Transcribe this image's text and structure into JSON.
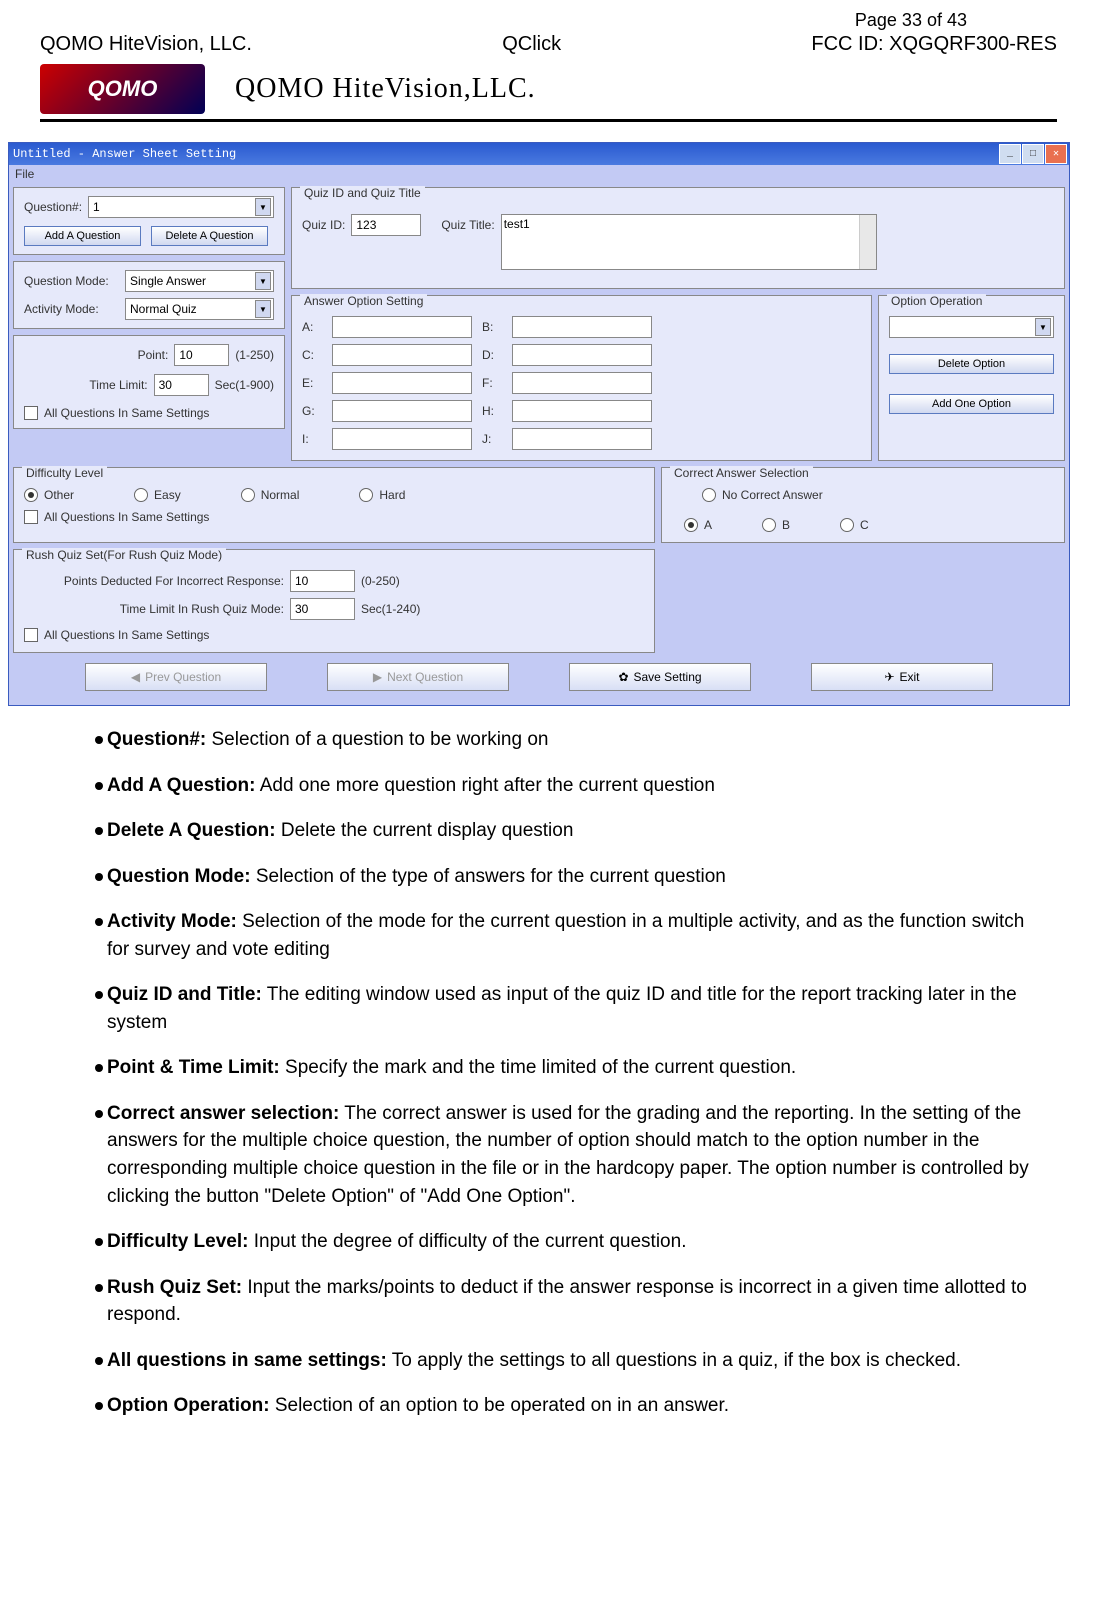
{
  "header": {
    "page_num": "Page 33 of 43",
    "company": "QOMO HiteVision, LLC.",
    "product": "QClick",
    "fcc": "FCC ID: XQGQRF300-RES",
    "logo_text": "QOMO",
    "logo_sub": "QOMO HiteVision,LLC."
  },
  "window": {
    "title": "Untitled - Answer Sheet Setting",
    "menu_file": "File",
    "left": {
      "question_num_label": "Question#:",
      "question_num_value": "1",
      "add_question_btn": "Add A Question",
      "delete_question_btn": "Delete A Question",
      "question_mode_label": "Question Mode:",
      "question_mode_value": "Single Answer",
      "activity_mode_label": "Activity Mode:",
      "activity_mode_value": "Normal Quiz",
      "point_label": "Point:",
      "point_value": "10",
      "point_range": "(1-250)",
      "time_limit_label": "Time Limit:",
      "time_limit_value": "30",
      "time_limit_range": "Sec(1-900)",
      "all_same_1": "All Questions In Same Settings"
    },
    "quiz": {
      "fieldset_label": "Quiz ID and Quiz Title",
      "quiz_id_label": "Quiz ID:",
      "quiz_id_value": "123",
      "quiz_title_label": "Quiz Title:",
      "quiz_title_value": "test1"
    },
    "answers": {
      "fieldset_label": "Answer Option Setting",
      "A": "A:",
      "B": "B:",
      "C": "C:",
      "D": "D:",
      "E": "E:",
      "F": "F:",
      "G": "G:",
      "H": "H:",
      "I": "I:",
      "J": "J:"
    },
    "option_op": {
      "fieldset_label": "Option Operation",
      "delete_btn": "Delete Option",
      "add_btn": "Add One Option"
    },
    "difficulty": {
      "fieldset_label": "Difficulty Level",
      "other": "Other",
      "easy": "Easy",
      "normal": "Normal",
      "hard": "Hard",
      "all_same": "All Questions In Same Settings"
    },
    "correct": {
      "fieldset_label": "Correct Answer Selection",
      "no_correct": "No Correct Answer",
      "A": "A",
      "B": "B",
      "C": "C"
    },
    "rush": {
      "fieldset_label": "Rush Quiz Set(For Rush Quiz Mode)",
      "points_label": "Points Deducted For Incorrect Response:",
      "points_value": "10",
      "points_range": "(0-250)",
      "time_label": "Time Limit In Rush Quiz Mode:",
      "time_value": "30",
      "time_range": "Sec(1-240)",
      "all_same": "All Questions In Same Settings"
    },
    "buttons": {
      "prev": "Prev Question",
      "next": "Next Question",
      "save": "Save Setting",
      "exit": "Exit"
    }
  },
  "bullets": [
    {
      "term": "Question#:",
      "desc": " Selection of a question to be working on"
    },
    {
      "term": "Add A Question:",
      "desc": " Add one more question right after the current question"
    },
    {
      "term": "Delete A Question:",
      "desc": " Delete the current display question"
    },
    {
      "term": "Question Mode:",
      "desc": " Selection of the type of answers for the current question"
    },
    {
      "term": "Activity Mode:",
      "desc": " Selection of the mode for the current question in a multiple activity, and as the function switch for survey and vote editing"
    },
    {
      "term": "Quiz ID and Title:",
      "desc": " The editing window used as input of the quiz ID and title for the report tracking later in the system"
    },
    {
      "term": "Point & Time Limit:",
      "desc": " Specify the mark and the time limited of the current question."
    },
    {
      "term": "Correct answer selection:",
      "desc": " The correct answer is used for the grading and the reporting. In the setting of the answers for the multiple choice question, the number of option should match to the option number in the corresponding multiple choice question in the file or in the hardcopy paper. The option number is controlled by clicking the button \"Delete Option\" of \"Add One Option\"."
    },
    {
      "term": "Difficulty Level:",
      "desc": " Input the degree of difficulty of the current question."
    },
    {
      "term": "Rush Quiz Set:",
      "desc": " Input the marks/points to deduct if the answer response is incorrect in a given time allotted to respond."
    },
    {
      "term": "All questions in same settings:",
      "desc": " To apply the settings to all questions in a quiz, if the box is checked."
    },
    {
      "term": "Option Operation:",
      "desc": " Selection of an option to be operated on in an answer."
    }
  ]
}
